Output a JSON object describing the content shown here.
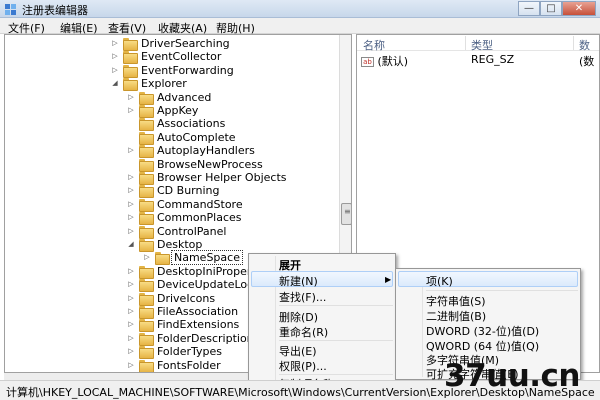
{
  "window": {
    "title": "注册表编辑器",
    "minimize": "—",
    "maximize": "□",
    "close": "✕"
  },
  "menu": [
    "文件(F)",
    "编辑(E)",
    "查看(V)",
    "收藏夹(A)",
    "帮助(H)"
  ],
  "tree": [
    {
      "label": "DriverSearching",
      "toggle": "▷"
    },
    {
      "label": "EventCollector",
      "toggle": "▷"
    },
    {
      "label": "EventForwarding",
      "toggle": "▷"
    },
    {
      "label": "Explorer",
      "toggle": "◢"
    },
    {
      "label": "Advanced",
      "toggle": "▷"
    },
    {
      "label": "AppKey",
      "toggle": "▷"
    },
    {
      "label": "Associations",
      "toggle": ""
    },
    {
      "label": "AutoComplete",
      "toggle": ""
    },
    {
      "label": "AutoplayHandlers",
      "toggle": "▷"
    },
    {
      "label": "BrowseNewProcess",
      "toggle": ""
    },
    {
      "label": "Browser Helper Objects",
      "toggle": "▷"
    },
    {
      "label": "CD Burning",
      "toggle": "▷"
    },
    {
      "label": "CommandStore",
      "toggle": "▷"
    },
    {
      "label": "CommonPlaces",
      "toggle": "▷"
    },
    {
      "label": "ControlPanel",
      "toggle": "▷"
    },
    {
      "label": "Desktop",
      "toggle": "◢"
    },
    {
      "label": "NameSpace",
      "toggle": "▷",
      "selected": true
    },
    {
      "label": "DesktopIniProper",
      "toggle": "▷"
    },
    {
      "label": "DeviceUpdateLoc",
      "toggle": "▷"
    },
    {
      "label": "DriveIcons",
      "toggle": "▷"
    },
    {
      "label": "FileAssociation",
      "toggle": "▷"
    },
    {
      "label": "FindExtensions",
      "toggle": "▷"
    },
    {
      "label": "FolderDescription",
      "toggle": "▷"
    },
    {
      "label": "FolderTypes",
      "toggle": "▷"
    },
    {
      "label": "FontsFolder",
      "toggle": "▷"
    }
  ],
  "values_pane": {
    "columns": [
      "名称",
      "类型",
      "数"
    ],
    "rows": [
      {
        "icon": "ab",
        "name": "(默认)",
        "type": "REG_SZ",
        "data": "(数"
      }
    ]
  },
  "context_menu": {
    "items": [
      "展开",
      "新建(N)",
      "查找(F)...",
      "删除(D)",
      "重命名(R)",
      "导出(E)",
      "权限(P)...",
      "复制项名称(C)"
    ]
  },
  "submenu": {
    "items": [
      "项(K)",
      "字符串值(S)",
      "二进制值(B)",
      "DWORD (32-位)值(D)",
      "QWORD (64 位)值(Q)",
      "多字符串值(M)",
      "可扩充字符串值(E)"
    ]
  },
  "statusbar": {
    "path": "计算机\\HKEY_LOCAL_MACHINE\\SOFTWARE\\Microsoft\\Windows\\CurrentVersion\\Explorer\\Desktop\\NameSpace"
  },
  "watermark": "37uu.cn"
}
